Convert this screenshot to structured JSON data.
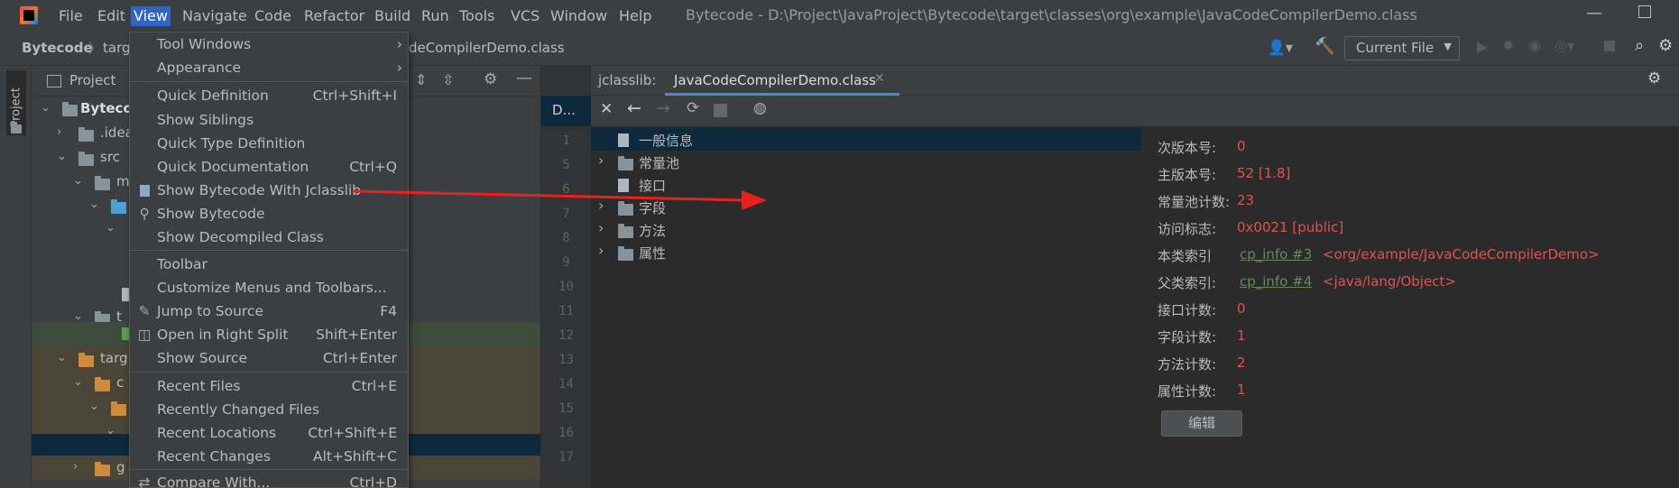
{
  "menubar": {
    "app_icon": "intellij-logo-icon",
    "items": [
      "File",
      "Edit",
      "View",
      "Navigate",
      "Code",
      "Refactor",
      "Build",
      "Run",
      "Tools",
      "VCS",
      "Window",
      "Help"
    ],
    "window_title": "Bytecode - D:\\Project\\JavaProject\\Bytecode\\target\\classes\\org\\example\\JavaCodeCompilerDemo.class"
  },
  "navbar": {
    "crumb1": "Bytecode",
    "crumb2": "targ",
    "crumb3": "deCompilerDemo.class",
    "run_config": "Current File"
  },
  "project": {
    "label": "Project",
    "strip_label": "Project",
    "rows": [
      "Byteco",
      ".idea",
      "src",
      "m",
      "",
      "",
      "",
      "t",
      "",
      "targ",
      "c",
      "",
      "",
      "",
      "g"
    ]
  },
  "tabs": {
    "left_tab": "D...",
    "jclasslib_label": "jclasslib:",
    "file_tab": "JavaCodeCompilerDemo.class"
  },
  "gutter": [
    "1",
    "5",
    "6",
    "7",
    "8",
    "9",
    "10",
    "11",
    "12",
    "13",
    "14",
    "15",
    "16",
    "17"
  ],
  "jtree": [
    "一般信息",
    "常量池",
    "接口",
    "字段",
    "方法",
    "属性"
  ],
  "info": {
    "minor_label": "次版本号:",
    "minor_val": "0",
    "major_label": "主版本号:",
    "major_val": "52 [1.8]",
    "cp_label": "常量池计数:",
    "cp_val": "23",
    "access_label": "访问标志:",
    "access_val": "0x0021 [public]",
    "this_label": "本类索引",
    "this_link": "cp_info #3",
    "this_val": "<org/example/JavaCodeCompilerDemo>",
    "super_label": "父类索引:",
    "super_link": "cp_info #4",
    "super_val": "<java/lang/Object>",
    "iface_label": "接口计数:",
    "iface_val": "0",
    "field_label": "字段计数:",
    "field_val": "1",
    "method_label": "方法计数:",
    "method_val": "2",
    "attr_label": "属性计数:",
    "attr_val": "1",
    "edit_button": "编辑"
  },
  "dropdown": {
    "items": [
      {
        "label": "Tool Windows",
        "shortcut": "",
        "submenu": true
      },
      {
        "label": "Appearance",
        "shortcut": "",
        "submenu": true
      },
      {
        "label": "Quick Definition",
        "shortcut": "Ctrl+Shift+I"
      },
      {
        "label": "Show Siblings",
        "shortcut": ""
      },
      {
        "label": "Quick Type Definition",
        "shortcut": ""
      },
      {
        "label": "Quick Documentation",
        "shortcut": "Ctrl+Q"
      },
      {
        "label": "Show Bytecode With Jclasslib",
        "shortcut": "",
        "icon": "jclasslib-icon"
      },
      {
        "label": "Show Bytecode",
        "shortcut": "",
        "icon": "bytecode-icon"
      },
      {
        "label": "Show Decompiled Class",
        "shortcut": ""
      },
      {
        "label": "Toolbar",
        "shortcut": ""
      },
      {
        "label": "Customize Menus and Toolbars...",
        "shortcut": ""
      },
      {
        "label": "Jump to Source",
        "shortcut": "F4",
        "icon": "pencil-icon"
      },
      {
        "label": "Open in Right Split",
        "shortcut": "Shift+Enter",
        "icon": "split-icon"
      },
      {
        "label": "Show Source",
        "shortcut": "Ctrl+Enter"
      },
      {
        "label": "Recent Files",
        "shortcut": "Ctrl+E"
      },
      {
        "label": "Recently Changed Files",
        "shortcut": ""
      },
      {
        "label": "Recent Locations",
        "shortcut": "Ctrl+Shift+E"
      },
      {
        "label": "Recent Changes",
        "shortcut": "Alt+Shift+C"
      },
      {
        "label": "Compare With...",
        "shortcut": "Ctrl+D",
        "icon": "compare-icon"
      }
    ]
  },
  "colors": {
    "accent": "#2f65ca",
    "arrow": "#e8211f",
    "value_red": "#e05252",
    "link_green": "#6a8759"
  }
}
